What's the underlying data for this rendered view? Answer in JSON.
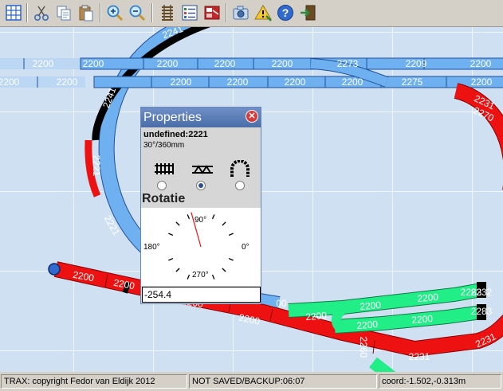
{
  "toolbar": {
    "buttons": [
      {
        "name": "grid-icon",
        "color": "#2b63c9"
      },
      {
        "name": "scissors-icon",
        "color": "#3b6fb8"
      },
      {
        "name": "copy-icon",
        "color": "#5a7fb0"
      },
      {
        "name": "paste-icon",
        "color": "#7b5a2a"
      },
      {
        "name": "zoom-in-icon",
        "color": "#2f7fd0"
      },
      {
        "name": "zoom-out-icon",
        "color": "#2f7fd0"
      },
      {
        "name": "track-icon",
        "color": "#5b4a32"
      },
      {
        "name": "list-icon",
        "color": "#2e4f8a"
      },
      {
        "name": "locomotive-icon",
        "color": "#c0282a"
      },
      {
        "name": "camera-icon",
        "color": "#3f6fa8"
      },
      {
        "name": "warning-icon",
        "color": "#e0b020"
      },
      {
        "name": "help-icon",
        "color": "#2f6ad0"
      },
      {
        "name": "exit-icon",
        "color": "#2e7a3a"
      }
    ]
  },
  "layout": {
    "tracks": [
      {
        "label": "2241",
        "color": "blue"
      },
      {
        "label": "2200",
        "color": "blue"
      },
      {
        "label": "2200",
        "color": "blue"
      },
      {
        "label": "2200",
        "color": "blue"
      },
      {
        "label": "2200",
        "color": "blue"
      },
      {
        "label": "2200",
        "color": "blue"
      },
      {
        "label": "2273",
        "color": "blue"
      },
      {
        "label": "2209",
        "color": "blue"
      },
      {
        "label": "2200",
        "color": "blue"
      },
      {
        "label": "2200",
        "color": "blue"
      },
      {
        "label": "2200",
        "color": "blue"
      },
      {
        "label": "2200",
        "color": "blue"
      },
      {
        "label": "2200",
        "color": "blue"
      },
      {
        "label": "2200",
        "color": "blue"
      },
      {
        "label": "2200",
        "color": "blue"
      },
      {
        "label": "2275",
        "color": "blue"
      },
      {
        "label": "2200",
        "color": "blue"
      },
      {
        "label": "2241",
        "color": "blue"
      },
      {
        "label": "2221",
        "color": "blue"
      },
      {
        "label": "2221",
        "color": "blue"
      },
      {
        "label": "2231",
        "color": "red"
      },
      {
        "label": "2200",
        "color": "red"
      },
      {
        "label": "2200",
        "color": "red"
      },
      {
        "label": "2200",
        "color": "red"
      },
      {
        "label": "2200",
        "color": "red"
      },
      {
        "label": "2260",
        "color": "red"
      },
      {
        "label": "2231",
        "color": "red"
      },
      {
        "label": "2231",
        "color": "red"
      },
      {
        "label": "2270",
        "color": "green"
      },
      {
        "label": "2200",
        "color": "green"
      },
      {
        "label": "2200",
        "color": "green"
      },
      {
        "label": "2200",
        "color": "green"
      },
      {
        "label": "2283",
        "color": "green"
      },
      {
        "label": "2232",
        "color": "green"
      },
      {
        "label": "2200",
        "color": "green"
      },
      {
        "label": "2200",
        "color": "green"
      },
      {
        "label": "2283",
        "color": "green"
      },
      {
        "label": "00",
        "color": "blue"
      }
    ],
    "colors": {
      "blue": "#6fb0f0",
      "red": "#ee1111",
      "green": "#22ee88",
      "black": "#000000",
      "outline": "#1f4f99"
    }
  },
  "properties": {
    "title": "Properties",
    "close_label": "✕",
    "element_id": "undefined:2221",
    "spec": "30°/360mm",
    "types": [
      {
        "name": "straight-track-icon",
        "selected": false
      },
      {
        "name": "bridge-icon",
        "selected": true
      },
      {
        "name": "tunnel-icon",
        "selected": false
      }
    ],
    "rotation_label": "Rotatie",
    "dial": {
      "label_0": "0°",
      "label_90": "90°",
      "label_180": "180°",
      "label_270": "270°"
    },
    "rotation_value": "-254.4",
    "rotation_degrees": -254.4
  },
  "status": {
    "copyright": "TRAX: copyright Fedor van Eldijk 2012",
    "save_state": "NOT SAVED/BACKUP:06:07",
    "coord": "coord:-1.502,-0.313m"
  }
}
